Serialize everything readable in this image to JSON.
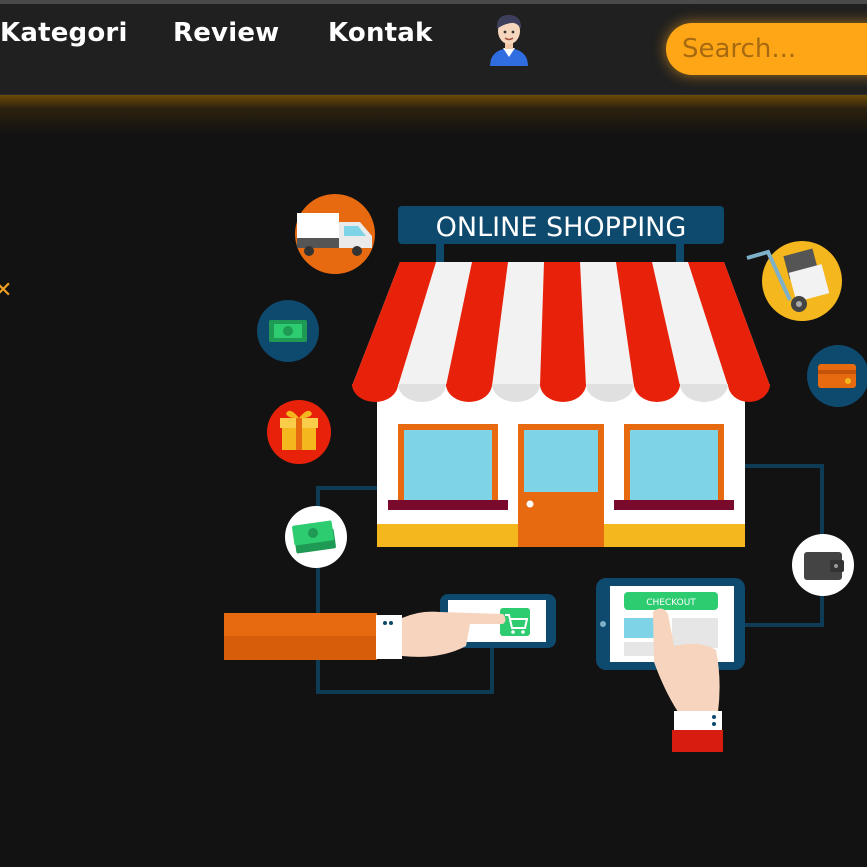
{
  "nav": {
    "links": [
      "Kategori",
      "Review",
      "Kontak"
    ],
    "avatar_icon": "user-avatar-icon",
    "search_placeholder": "Search..."
  },
  "hero": {
    "store_sign": "ONLINE SHOPPING",
    "checkout_button": "CHECKOUT",
    "icons": [
      "delivery-truck-icon",
      "cash-icon",
      "gift-icon",
      "money-icon",
      "hand-truck-icon",
      "credit-card-icon",
      "wallet-icon",
      "shopping-cart-icon"
    ]
  },
  "colors": {
    "accent": "#ffa617",
    "navbar": "#202020",
    "background": "#121212",
    "awning_red": "#e8210a",
    "sign_blue": "#0d4a6e"
  }
}
